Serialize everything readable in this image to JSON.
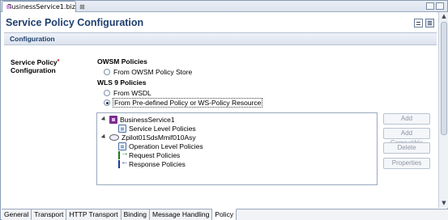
{
  "editor_tab": {
    "title": "BusinessService1.biz",
    "close": "⊠"
  },
  "page": {
    "title": "Service Policy Configuration"
  },
  "section": {
    "title": "Configuration"
  },
  "field": {
    "label_line1": "Service Policy",
    "required_mark": "*",
    "label_line2": "Configuration"
  },
  "owsm": {
    "heading": "OWSM Policies",
    "option_store": "From OWSM Policy Store"
  },
  "wls": {
    "heading": "WLS 9 Policies",
    "option_wsdl": "From WSDL",
    "option_predefined": "From Pre-defined Policy or WS-Policy Resource",
    "selected": "From Pre-defined Policy or WS-Policy Resource"
  },
  "tree": {
    "service": "BusinessService1",
    "service_level": "Service Level Policies",
    "operation": "Zpilot01SdsMmif010Asy",
    "operation_level": "Operation Level Policies",
    "request": "Request Policies",
    "response": "Response Policies"
  },
  "buttons": {
    "add": "Add",
    "add_compatible": "Add Compatible",
    "delete": "Delete",
    "properties": "Properties"
  },
  "bottom_tabs": [
    "General",
    "Transport",
    "HTTP Transport",
    "Binding",
    "Message Handling",
    "Policy"
  ],
  "active_bottom_tab": "Policy",
  "icons": {
    "editor": "business-service-icon",
    "layout_a": "grid-layout-icon",
    "layout_b": "list-layout-icon"
  },
  "colors": {
    "title": "#1f3f6e",
    "required": "#c00000",
    "service_icon": "#7a2c8e"
  }
}
